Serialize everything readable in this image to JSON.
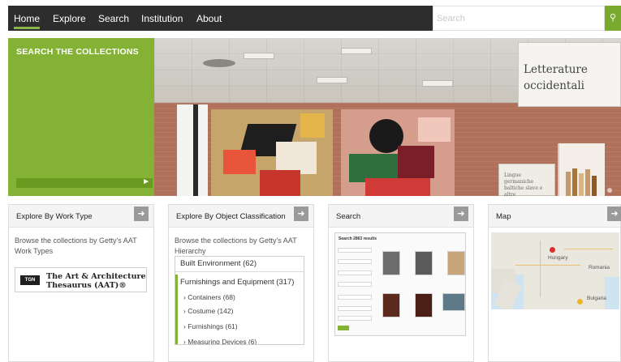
{
  "nav": {
    "items": [
      "Home",
      "Explore",
      "Search",
      "Institution",
      "About"
    ],
    "active": "Home",
    "search_placeholder": "Search",
    "search_button_icon": "search-icon"
  },
  "hero": {
    "title": "SEARCH THE COLLECTIONS",
    "sign_line1": "Letterature",
    "sign_line2": "occidentali",
    "small_sign_line1": "Lingue germaniche",
    "small_sign_line2": "baltiche slave e altre",
    "next_icon": "arrow-right-icon"
  },
  "cards": {
    "worktype": {
      "title": "Explore By Work Type",
      "desc": "Browse the collections by Getty's AAT Work Types",
      "aat_logo": "TGN",
      "aat_line1": "The Art & Architecture",
      "aat_line2": "Thesaurus (AAT)®"
    },
    "classification": {
      "title": "Explore By Object Classification",
      "desc": "Browse the collections by Getty's AAT Hierarchy",
      "items": [
        {
          "label": "Built Environment (62)"
        },
        {
          "label": "Furnishings and Equipment (317)"
        }
      ],
      "sub_items": [
        {
          "label": "Containers (68)"
        },
        {
          "label": "Costume (142)"
        },
        {
          "label": "Furnishings (61)"
        },
        {
          "label": "Measuring Devices (6)"
        }
      ]
    },
    "search": {
      "title": "Search",
      "shot_title": "Search 2863 results"
    },
    "map": {
      "title": "Map",
      "labels": [
        "Hungary",
        "Romania",
        "Bulgaria"
      ]
    }
  },
  "colors": {
    "accent": "#84b234",
    "nav_bg": "#2d2d2d"
  }
}
